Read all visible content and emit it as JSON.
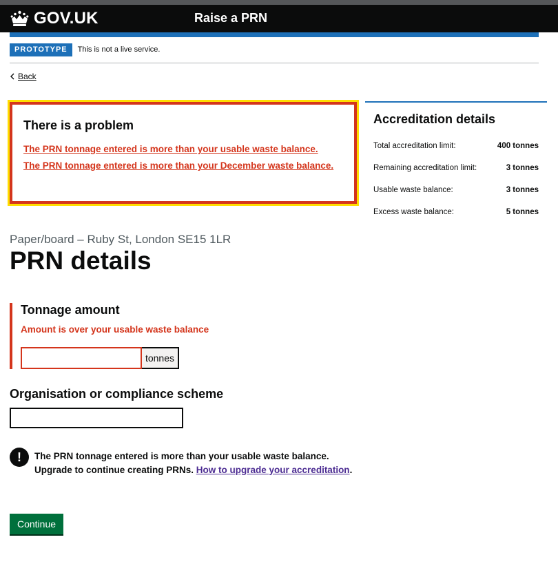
{
  "header": {
    "logo_text": "GOV.UK",
    "service_name": "Raise a PRN"
  },
  "phase_banner": {
    "tag": "PROTOTYPE",
    "text": "This is not a live service."
  },
  "back_link": "Back",
  "error_summary": {
    "title": "There is a problem",
    "errors": [
      "The PRN tonnage entered is more than your usable waste balance.",
      "The PRN tonnage entered is more than your December waste balance."
    ]
  },
  "accreditation": {
    "title": "Accreditation details",
    "rows": [
      {
        "label": "Total accreditation limit:",
        "value": "400 tonnes"
      },
      {
        "label": "Remaining accreditation limit:",
        "value": "3 tonnes"
      },
      {
        "label": "Usable waste balance:",
        "value": "3 tonnes"
      },
      {
        "label": "Excess waste balance:",
        "value": "5 tonnes"
      }
    ]
  },
  "page": {
    "caption": "Paper/board – Ruby St, London SE15 1LR",
    "title": "PRN details"
  },
  "tonnage": {
    "label": "Tonnage amount",
    "error": "Amount is over your usable waste balance",
    "value": "",
    "suffix": "tonnes"
  },
  "organisation": {
    "label": "Organisation or compliance scheme",
    "value": ""
  },
  "warning": {
    "icon": "!",
    "text_before": "The PRN tonnage entered is more than your usable waste balance. Upgrade to continue creating PRNs. ",
    "link_text": "How to upgrade your accreditation",
    "text_after": "."
  },
  "continue_label": "Continue",
  "colors": {
    "header_bg": "#0b0c0c",
    "brand_blue": "#1d70b8",
    "error_red": "#d4351c",
    "focus_yellow": "#ffdd00",
    "button_green": "#00703c",
    "visited_link": "#4c2c92"
  }
}
